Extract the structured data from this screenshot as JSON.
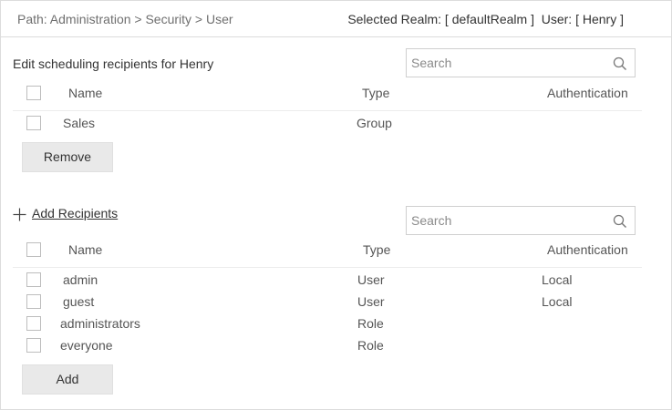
{
  "header": {
    "path": "Path: Administration > Security > User",
    "realm": "Selected Realm: [ defaultRealm ]  User: [ Henry ]"
  },
  "recipients": {
    "title": "Edit scheduling recipients for Henry",
    "search_placeholder": "Search",
    "columns": {
      "name": "Name",
      "type": "Type",
      "auth": "Authentication"
    },
    "rows": [
      {
        "name": "Sales",
        "type": "Group",
        "auth": ""
      }
    ],
    "remove_label": "Remove"
  },
  "add": {
    "link_label": "Add Recipients",
    "search_placeholder": "Search",
    "columns": {
      "name": "Name",
      "type": "Type",
      "auth": "Authentication"
    },
    "rows": [
      {
        "name": "admin",
        "type": "User",
        "auth": "Local"
      },
      {
        "name": "guest",
        "type": "User",
        "auth": "Local"
      },
      {
        "name": "administrators",
        "type": "Role",
        "auth": ""
      },
      {
        "name": "everyone",
        "type": "Role",
        "auth": ""
      }
    ],
    "add_label": "Add"
  }
}
